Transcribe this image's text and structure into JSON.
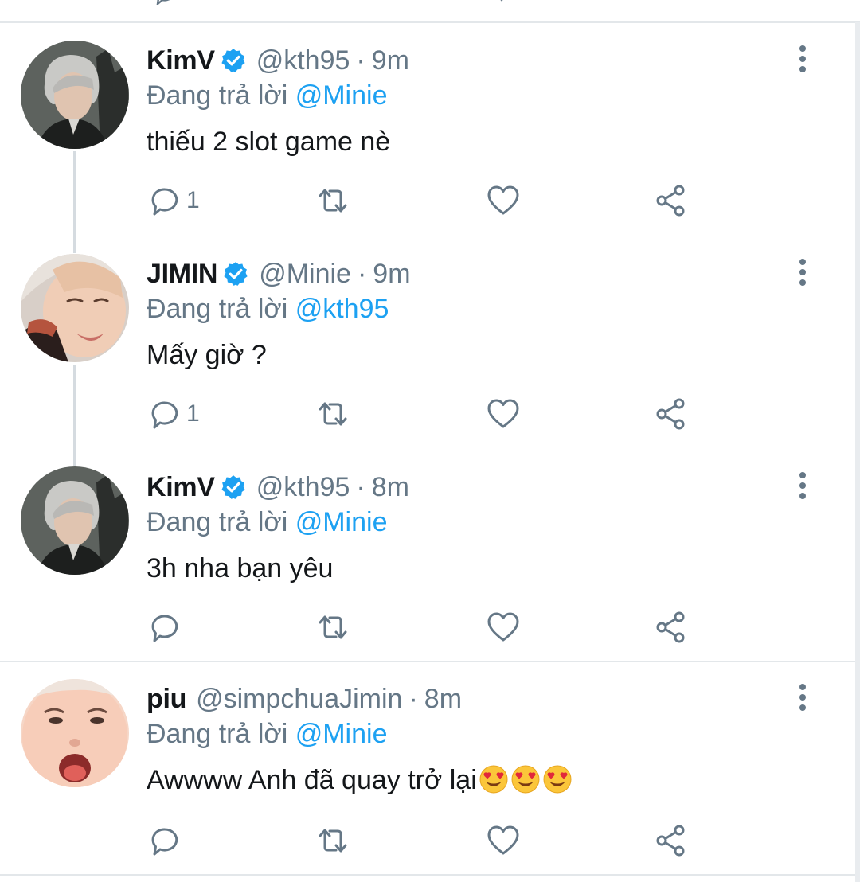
{
  "colors": {
    "accent": "#1da1f2",
    "muted": "#657786",
    "text": "#14171a",
    "divider": "#e3e7ea"
  },
  "tweets": [
    {
      "name": "KimV",
      "verified": true,
      "handle": "@kth95",
      "separator": "·",
      "time": "9m",
      "reply_prefix": "Đang trả lời",
      "reply_to": "@Minie",
      "text": "thiếu 2 slot game nè",
      "reply_count": "1",
      "emoji": []
    },
    {
      "name": "JIMIN",
      "verified": true,
      "handle": "@Minie",
      "separator": "·",
      "time": "9m",
      "reply_prefix": "Đang trả lời",
      "reply_to": "@kth95",
      "text": "Mấy giờ ?",
      "reply_count": "1",
      "emoji": []
    },
    {
      "name": "KimV",
      "verified": true,
      "handle": "@kth95",
      "separator": "·",
      "time": "8m",
      "reply_prefix": "Đang trả lời",
      "reply_to": "@Minie",
      "text": "3h nha bạn yêu",
      "reply_count": "",
      "emoji": []
    },
    {
      "name": "piu",
      "verified": false,
      "handle": "@simpchuaJimin",
      "separator": "·",
      "time": "8m",
      "reply_prefix": "Đang trả lời",
      "reply_to": "@Minie",
      "text": "Awwww Anh đã quay trở lại",
      "reply_count": "",
      "emoji": [
        "heart-eyes-emoji",
        "heart-eyes-emoji",
        "heart-eyes-emoji"
      ]
    }
  ],
  "icons": {
    "reply": "reply-icon",
    "retweet": "retweet-icon",
    "like": "heart-icon",
    "share": "share-icon",
    "more": "more-vertical-icon",
    "verified": "verified-badge-icon"
  }
}
